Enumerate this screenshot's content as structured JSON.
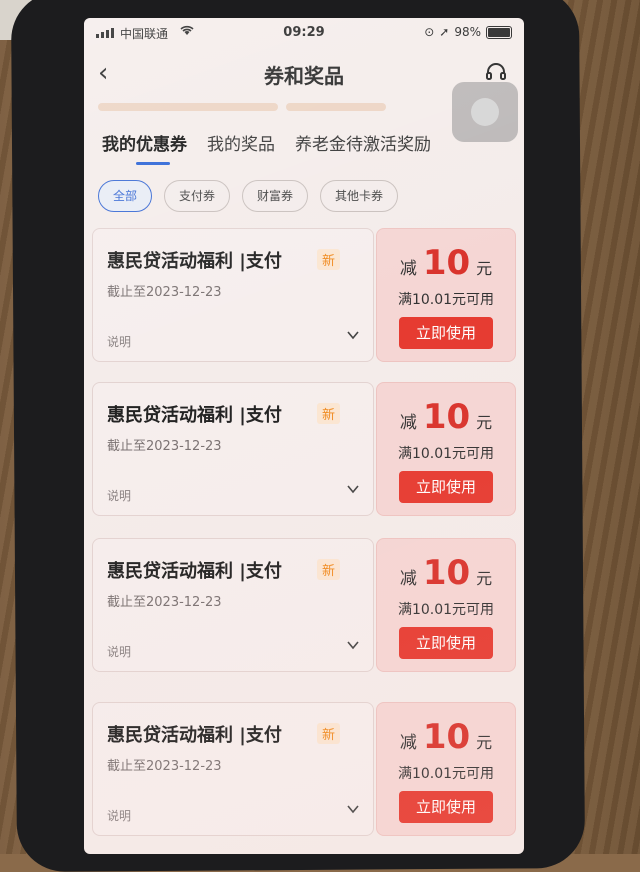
{
  "status_bar": {
    "carrier": "中国联通",
    "time": "09:29",
    "battery": "98%"
  },
  "nav": {
    "title": "券和奖品"
  },
  "tabs": [
    {
      "label": "我的优惠券",
      "active": true
    },
    {
      "label": "我的奖品",
      "active": false
    },
    {
      "label": "养老金待激活奖励",
      "active": false
    }
  ],
  "filters": [
    {
      "label": "全部",
      "active": true
    },
    {
      "label": "支付券",
      "active": false
    },
    {
      "label": "财富券",
      "active": false
    },
    {
      "label": "其他卡券",
      "active": false
    }
  ],
  "coupons": [
    {
      "title": "惠民贷活动福利 |支付",
      "badge": "新",
      "expiry": "截止至2023-12-23",
      "explain": "说明",
      "prefix": "减",
      "amount": "10",
      "unit": "元",
      "condition": "满10.01元可用",
      "button": "立即使用"
    },
    {
      "title": "惠民贷活动福利 |支付",
      "badge": "新",
      "expiry": "截止至2023-12-23",
      "explain": "说明",
      "prefix": "减",
      "amount": "10",
      "unit": "元",
      "condition": "满10.01元可用",
      "button": "立即使用"
    },
    {
      "title": "惠民贷活动福利 |支付",
      "badge": "新",
      "expiry": "截止至2023-12-23",
      "explain": "说明",
      "prefix": "减",
      "amount": "10",
      "unit": "元",
      "condition": "满10.01元可用",
      "button": "立即使用"
    },
    {
      "title": "惠民贷活动福利 |支付",
      "badge": "新",
      "expiry": "截止至2023-12-23",
      "explain": "说明",
      "prefix": "减",
      "amount": "10",
      "unit": "元",
      "condition": "满10.01元可用",
      "button": "立即使用"
    }
  ],
  "colors": {
    "accent_red": "#e63a30",
    "tab_underline": "#2a63d6",
    "new_badge": "#f08a1e"
  }
}
